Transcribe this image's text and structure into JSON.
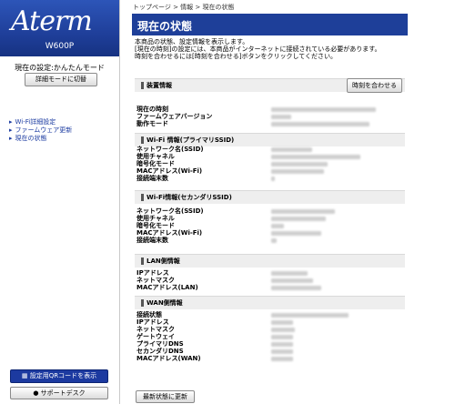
{
  "sidebar": {
    "logo": "Aterm",
    "model": "W600P",
    "mode_text": "現在の設定:かんたんモード",
    "mode_button": "詳細モードに切替",
    "nav": [
      {
        "label": "Wi-Fi詳細設定"
      },
      {
        "label": "ファームウェア更新"
      },
      {
        "label": "現在の状態"
      }
    ],
    "qr_button": "設定用QRコードを表示",
    "support_button": "サポートデスク"
  },
  "main": {
    "breadcrumb": "トップページ > 情報 > 現在の状態",
    "title": "現在の状態",
    "intro": [
      "本商品の状態、設定情報を表示します。",
      "[現在の時刻]の設定には、本商品がインターネットに接続されている必要があります。",
      "時刻を合わせるには[時刻を合わせる]ボタンをクリックしてください。"
    ],
    "time_button": "時刻を合わせる",
    "refresh_button": "最新状態に更新"
  },
  "sections": [
    {
      "title": "装置情報",
      "rows": [
        "現在の時刻",
        "ファームウェアバージョン",
        "動作モード"
      ]
    },
    {
      "title": "Wi-Fi 情報(プライマリSSID)",
      "rows": [
        "ネットワーク名(SSID)",
        "使用チャネル",
        "暗号化モード",
        "MACアドレス(Wi-Fi)",
        "接続端末数"
      ]
    },
    {
      "title": "Wi-Fi情報(セカンダリSSID)",
      "rows": [
        "ネットワーク名(SSID)",
        "使用チャネル",
        "暗号化モード",
        "MACアドレス(Wi-Fi)",
        "接続端末数"
      ]
    },
    {
      "title": "LAN側情報",
      "rows": [
        "IPアドレス",
        "ネットマスク",
        "MACアドレス(LAN)"
      ]
    },
    {
      "title": "WAN側情報",
      "rows": [
        "接続状態",
        "IPアドレス",
        "ネットマスク",
        "ゲートウェイ",
        "プライマリDNS",
        "セカンダリDNS",
        "MACアドレス(WAN)"
      ]
    }
  ]
}
